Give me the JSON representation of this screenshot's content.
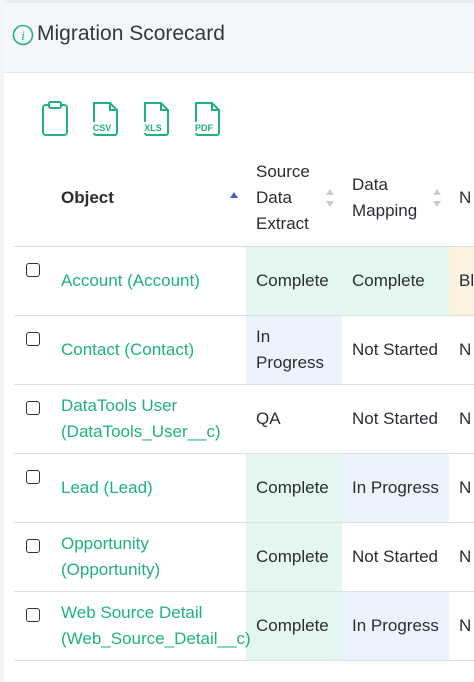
{
  "header": {
    "title": "Migration Scorecard",
    "info_icon": "info-circle-icon"
  },
  "toolbar": {
    "copy_icon": "clipboard-icon",
    "csv_label": "CSV",
    "xls_label": "XLS",
    "pdf_label": "PDF"
  },
  "colors": {
    "accent": "#1fb27f",
    "complete_bg": "#e3f7ee",
    "in_progress_bg": "#ebf4fd",
    "blocked_bg": "#fdf2df",
    "sort_active": "#4a5fc9"
  },
  "table": {
    "columns": [
      {
        "label": "Object"
      },
      {
        "label": "Source Data Extract"
      },
      {
        "label": "Data Mapping"
      },
      {
        "label": "N D"
      }
    ],
    "rows": [
      {
        "object": "Account (Account)",
        "source": "Complete",
        "mapping": "Complete",
        "next": "Bl"
      },
      {
        "object": "Contact (Contact)",
        "source": "In Progress",
        "mapping": "Not Started",
        "next": "N"
      },
      {
        "object": "DataTools User (DataTools_User__c)",
        "source": "QA",
        "mapping": "Not Started",
        "next": "N"
      },
      {
        "object": "Lead (Lead)",
        "source": "Complete",
        "mapping": "In Progress",
        "next": "N"
      },
      {
        "object": "Opportunity (Opportunity)",
        "source": "Complete",
        "mapping": "Not Started",
        "next": "N"
      },
      {
        "object": "Web Source Detail (Web_Source_Detail__c)",
        "source": "Complete",
        "mapping": "In Progress",
        "next": "N"
      }
    ]
  }
}
